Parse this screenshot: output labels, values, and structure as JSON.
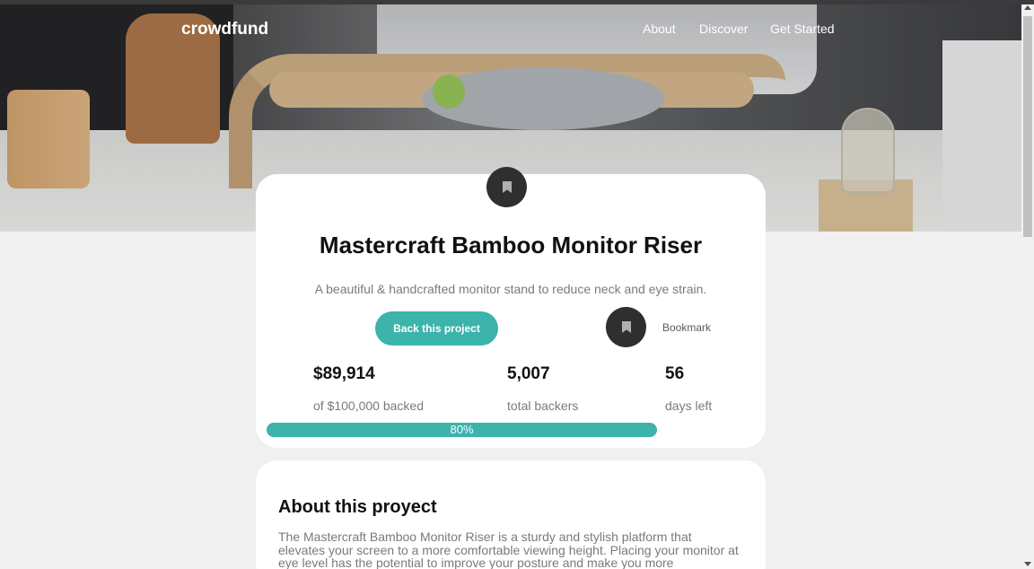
{
  "nav": {
    "logo": "crowdfund",
    "links": [
      "About",
      "Discover",
      "Get Started"
    ]
  },
  "project": {
    "title": "Mastercraft Bamboo Monitor Riser",
    "subtitle": "A beautiful & handcrafted monitor stand to reduce neck and eye strain.",
    "back_label": "Back this project",
    "bookmark_label": "Bookmark"
  },
  "stats": [
    {
      "value": "$89,914",
      "label": "of $100,000 backed"
    },
    {
      "value": "5,007",
      "label": "total backers"
    },
    {
      "value": "56",
      "label": "days left"
    }
  ],
  "progress": {
    "fraction": 0.8,
    "label": "80%"
  },
  "about": {
    "title": "About this proyect",
    "text": "The Mastercraft Bamboo Monitor Riser is a sturdy and stylish platform that elevates your screen to a more comfortable viewing height. Placing your monitor at eye level has the potential to improve your posture and make you more comfortable while at work, helping"
  },
  "colors": {
    "accent": "#3cb3ab",
    "dark": "#2f2f2f",
    "page_bg": "#f0f0f0"
  },
  "icons": {
    "logo_badge": "bookmark-icon",
    "bookmark_button": "bookmark-icon"
  }
}
